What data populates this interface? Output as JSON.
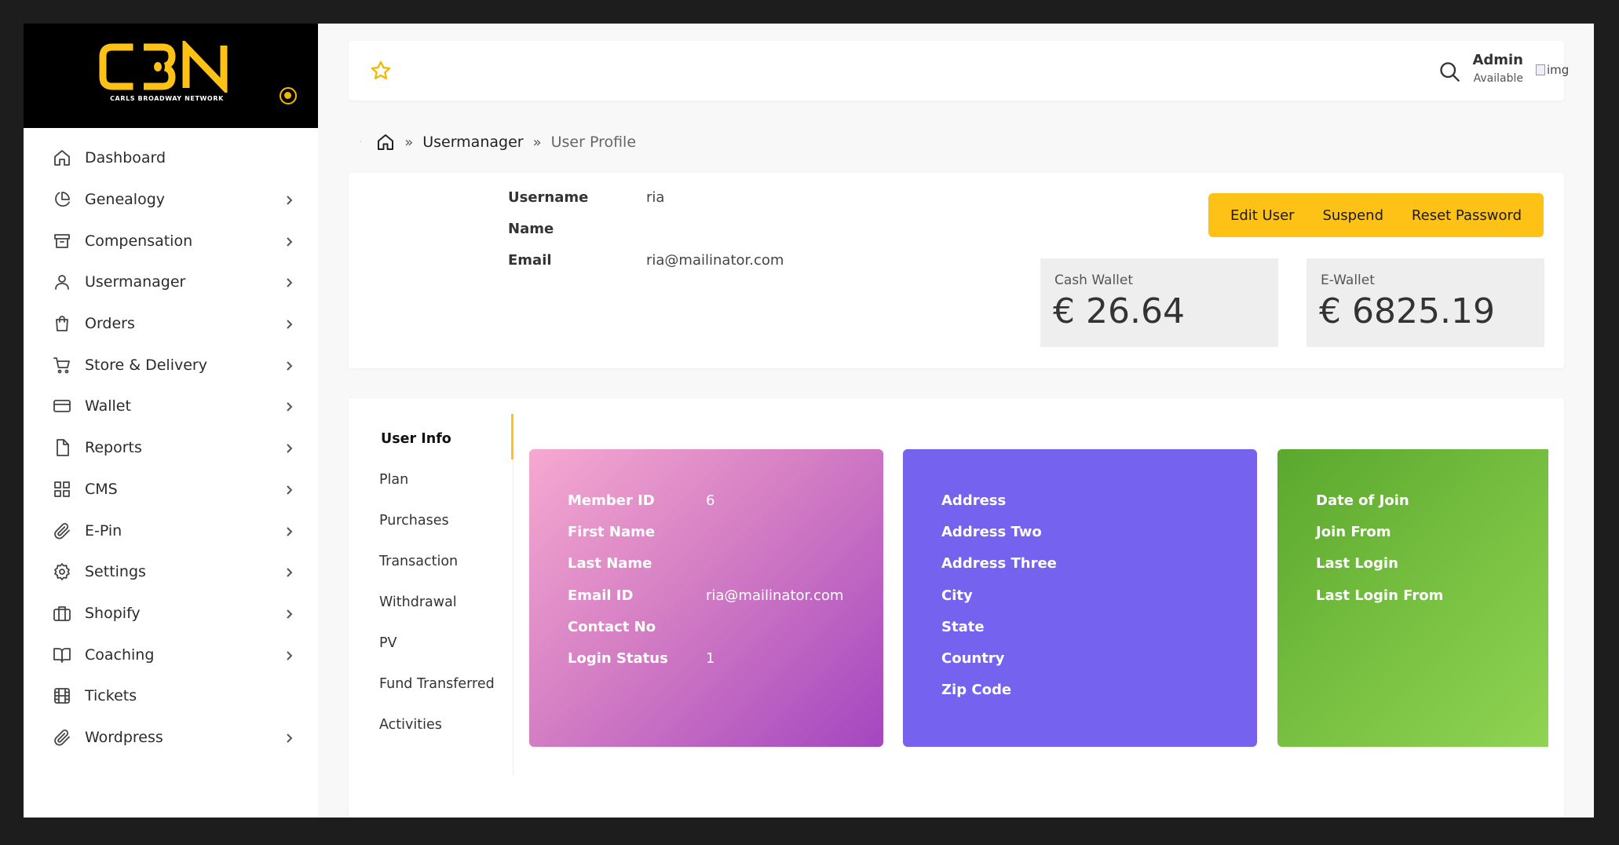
{
  "brand": {
    "logo_text": "C3N",
    "logo_subtitle": "CARLS BROADWAY NETWORK",
    "accent_color": "#fdc215",
    "toggle_icon": "circle-dot-icon"
  },
  "sidebar": {
    "items": [
      {
        "label": "Dashboard",
        "icon": "home-icon",
        "has_submenu": false
      },
      {
        "label": "Genealogy",
        "icon": "pie-chart-icon",
        "has_submenu": true
      },
      {
        "label": "Compensation",
        "icon": "archive-icon",
        "has_submenu": true
      },
      {
        "label": "Usermanager",
        "icon": "user-icon",
        "has_submenu": true
      },
      {
        "label": "Orders",
        "icon": "shopping-bag-icon",
        "has_submenu": true
      },
      {
        "label": "Store & Delivery",
        "icon": "cart-icon",
        "has_submenu": true
      },
      {
        "label": "Wallet",
        "icon": "credit-card-icon",
        "has_submenu": true
      },
      {
        "label": "Reports",
        "icon": "file-icon",
        "has_submenu": true
      },
      {
        "label": "CMS",
        "icon": "grid-icon",
        "has_submenu": true
      },
      {
        "label": "E-Pin",
        "icon": "paperclip-icon",
        "has_submenu": true
      },
      {
        "label": "Settings",
        "icon": "settings-icon",
        "has_submenu": true
      },
      {
        "label": "Shopify",
        "icon": "briefcase-icon",
        "has_submenu": true
      },
      {
        "label": "Coaching",
        "icon": "book-icon",
        "has_submenu": true
      },
      {
        "label": "Tickets",
        "icon": "film-icon",
        "has_submenu": false
      },
      {
        "label": "Wordpress",
        "icon": "paperclip-icon",
        "has_submenu": true
      }
    ]
  },
  "header": {
    "admin_name": "Admin",
    "admin_status": "Available",
    "avatar_alt": "img"
  },
  "breadcrumb": {
    "items": [
      "Usermanager",
      "User Profile"
    ]
  },
  "profile": {
    "fields": [
      {
        "label": "Username",
        "value": "ria"
      },
      {
        "label": "Name",
        "value": ""
      },
      {
        "label": "Email",
        "value": "ria@mailinator.com"
      }
    ],
    "actions": [
      "Edit User",
      "Suspend",
      "Reset Password"
    ],
    "wallets": [
      {
        "title": "Cash Wallet",
        "amount": "€ 26.64"
      },
      {
        "title": "E-Wallet",
        "amount": "€ 6825.19"
      }
    ]
  },
  "tabs": {
    "active": "User Info",
    "items": [
      "User Info",
      "Plan",
      "Purchases",
      "Transaction",
      "Withdrawal",
      "PV",
      "Fund Transferred",
      "Activities"
    ]
  },
  "user_info": {
    "basic": [
      {
        "label": "Member ID",
        "value": "6"
      },
      {
        "label": "First Name",
        "value": ""
      },
      {
        "label": "Last Name",
        "value": ""
      },
      {
        "label": "Email ID",
        "value": "ria@mailinator.com"
      },
      {
        "label": "Contact No",
        "value": ""
      },
      {
        "label": "Login Status",
        "value": "1"
      }
    ],
    "address": [
      {
        "label": "Address",
        "value": ""
      },
      {
        "label": "Address Two",
        "value": ""
      },
      {
        "label": "Address Three",
        "value": ""
      },
      {
        "label": "City",
        "value": ""
      },
      {
        "label": "State",
        "value": ""
      },
      {
        "label": "Country",
        "value": ""
      },
      {
        "label": "Zip Code",
        "value": ""
      }
    ],
    "activity": [
      {
        "label": "Date of Join",
        "value": ""
      },
      {
        "label": "Join From",
        "value": ""
      },
      {
        "label": "Last Login",
        "value": ""
      },
      {
        "label": "Last Login From",
        "value": ""
      }
    ]
  }
}
